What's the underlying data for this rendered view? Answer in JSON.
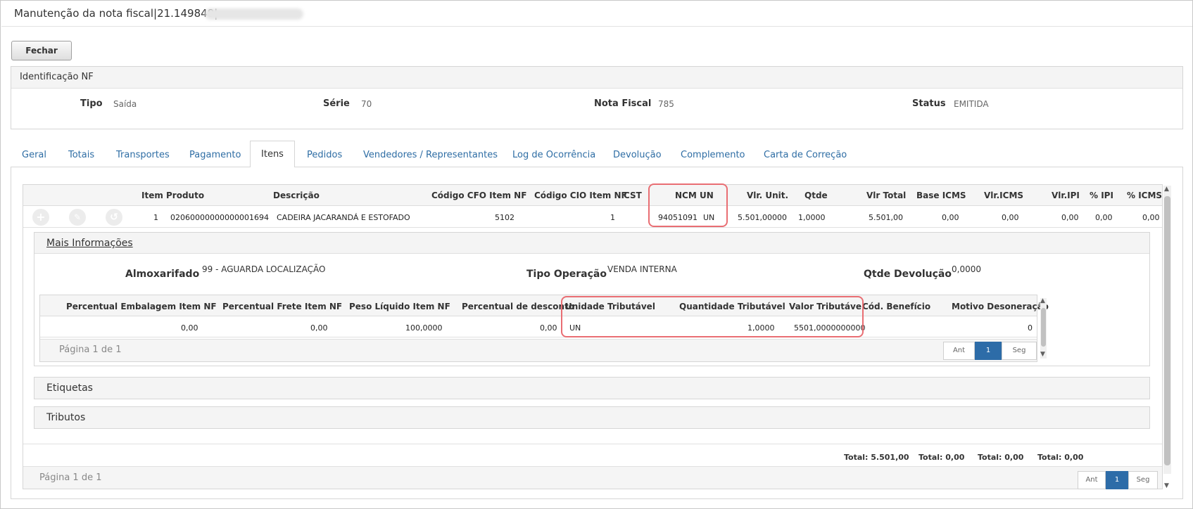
{
  "window": {
    "title": "Manutenção da nota fiscal|21.149848|"
  },
  "toolbar": {
    "close_label": "Fechar"
  },
  "ident": {
    "header": "Identificação NF",
    "tipo_label": "Tipo",
    "tipo_value": "Saída",
    "serie_label": "Série",
    "serie_value": "70",
    "nota_label": "Nota Fiscal",
    "nota_value": "785",
    "status_label": "Status",
    "status_value": "EMITIDA"
  },
  "tabs": [
    "Geral",
    "Totais",
    "Transportes",
    "Pagamento",
    "Itens",
    "Pedidos",
    "Vendedores / Representantes",
    "Log de Ocorrência",
    "Devolução",
    "Complemento",
    "Carta de Correção"
  ],
  "items_table": {
    "headers": [
      "Item",
      "Produto",
      "Descrição",
      "Código CFO Item NF",
      "Código CIO Item NF",
      "CST",
      "NCM",
      "UN",
      "Vlr. Unit.",
      "Qtde",
      "Vlr Total",
      "Base ICMS",
      "Vlr.ICMS",
      "Vlr.IPI",
      "% IPI",
      "% ICMS"
    ],
    "row": [
      "1",
      "02060000000000001694",
      "CADEIRA JACARANDÁ E ESTOFADO",
      "5102",
      "1",
      "",
      "94051091",
      "UN",
      "5.501,00000",
      "1,0000",
      "5.501,00",
      "0,00",
      "0,00",
      "0,00",
      "0,00",
      "0,00"
    ]
  },
  "mais_info": {
    "header": "Mais Informações",
    "almox_label": "Almoxarifado",
    "almox_value": "99 - AGUARDA LOCALIZAÇÃO",
    "tipo_op_label": "Tipo Operação",
    "tipo_op_value": "VENDA INTERNA",
    "qtde_dev_label": "Qtde Devolução",
    "qtde_dev_value": "0,0000",
    "sub_headers": [
      "Percentual Embalagem Item NF",
      "Percentual Frete Item NF",
      "Peso Líquido Item NF",
      "Percentual de desconto",
      "Unidade Tributável",
      "Quantidade Tributável",
      "Valor Tributável",
      "Cód. Benefício",
      "Motivo Desoneração"
    ],
    "sub_row": [
      "0,00",
      "0,00",
      "100,0000",
      "0,00",
      "UN",
      "1,0000",
      "5501,0000000000",
      "",
      "0"
    ],
    "page_text": "Página 1 de 1",
    "pager": {
      "prev": "Ant",
      "current": "1",
      "next": "Seg"
    }
  },
  "sections": {
    "etiquetas": "Etiquetas",
    "tributos": "Tributos"
  },
  "totals": [
    "Total: 5.501,00",
    "Total: 0,00",
    "Total: 0,00",
    "Total: 0,00"
  ],
  "footer": {
    "page_text": "Página 1 de 1",
    "pager": {
      "prev": "Ant",
      "current": "1",
      "next": "Seg"
    }
  }
}
